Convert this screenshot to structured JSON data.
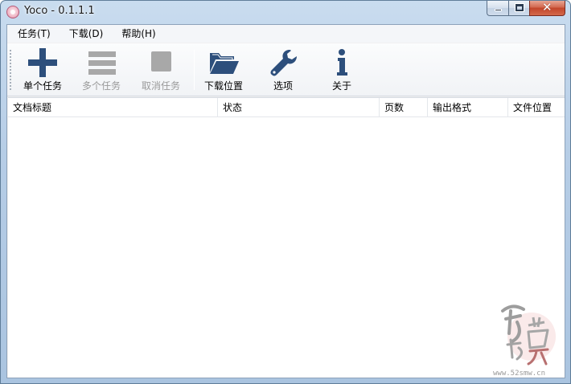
{
  "window": {
    "title": "Yoco - 0.1.1.1",
    "icon": "app-logo-icon",
    "caption_buttons": [
      "minimize-icon",
      "maximize-icon",
      "close-icon"
    ]
  },
  "menu": {
    "items": [
      {
        "label": "任务(T)"
      },
      {
        "label": "下载(D)"
      },
      {
        "label": "帮助(H)"
      }
    ]
  },
  "toolbar": {
    "buttons": [
      {
        "label": "单个任务",
        "icon": "plus-icon",
        "enabled": true
      },
      {
        "label": "多个任务",
        "icon": "list-icon",
        "enabled": false
      },
      {
        "label": "取消任务",
        "icon": "stop-icon",
        "enabled": false
      },
      {
        "label": "下载位置",
        "icon": "folder-icon",
        "enabled": true
      },
      {
        "label": "选项",
        "icon": "wrench-icon",
        "enabled": true
      },
      {
        "label": "关于",
        "icon": "info-icon",
        "enabled": true
      }
    ]
  },
  "table": {
    "columns": [
      "文档标题",
      "状态",
      "页数",
      "输出格式",
      "文件位置"
    ],
    "rows": []
  },
  "watermark": {
    "url_text": "www.52smw.cn"
  },
  "colors": {
    "icon_enabled": "#2d4f7c",
    "icon_disabled": "#a8a8a8",
    "label_disabled": "#9a9a9a",
    "title_bar": "#b6cde6",
    "close_button": "#c2452a"
  }
}
